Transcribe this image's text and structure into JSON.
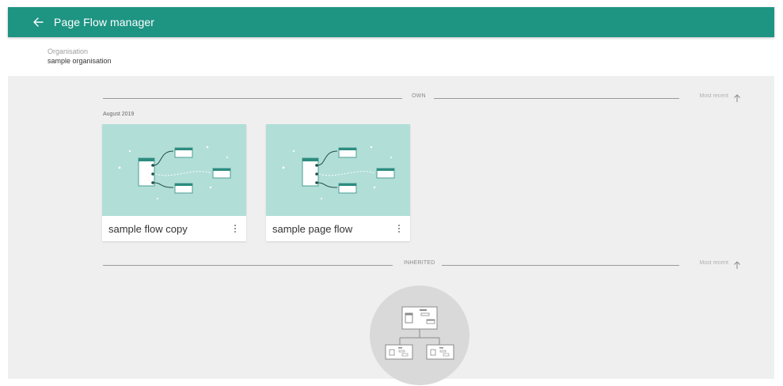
{
  "header": {
    "title": "Page Flow manager",
    "back_icon": "arrow-left-icon",
    "background_color": "#1e9483"
  },
  "organisation": {
    "label": "Organisation",
    "name": "sample organisation"
  },
  "own_section": {
    "label": "OWN",
    "sort_label": "Most recent",
    "sort_icon": "arrow-up-icon",
    "group_date": "August 2019",
    "cards": [
      {
        "title": "sample flow copy",
        "menu_icon": "kebab-menu-icon"
      },
      {
        "title": "sample page flow",
        "menu_icon": "kebab-menu-icon"
      }
    ]
  },
  "inherited_section": {
    "label": "INHERITED",
    "sort_label": "Most recent",
    "sort_icon": "arrow-up-icon",
    "empty_icon": "page-flow-hierarchy-illustration"
  },
  "colors": {
    "accent": "#1e9483",
    "card_thumbnail_bg": "#b2ded8",
    "content_bg": "#efefef"
  }
}
